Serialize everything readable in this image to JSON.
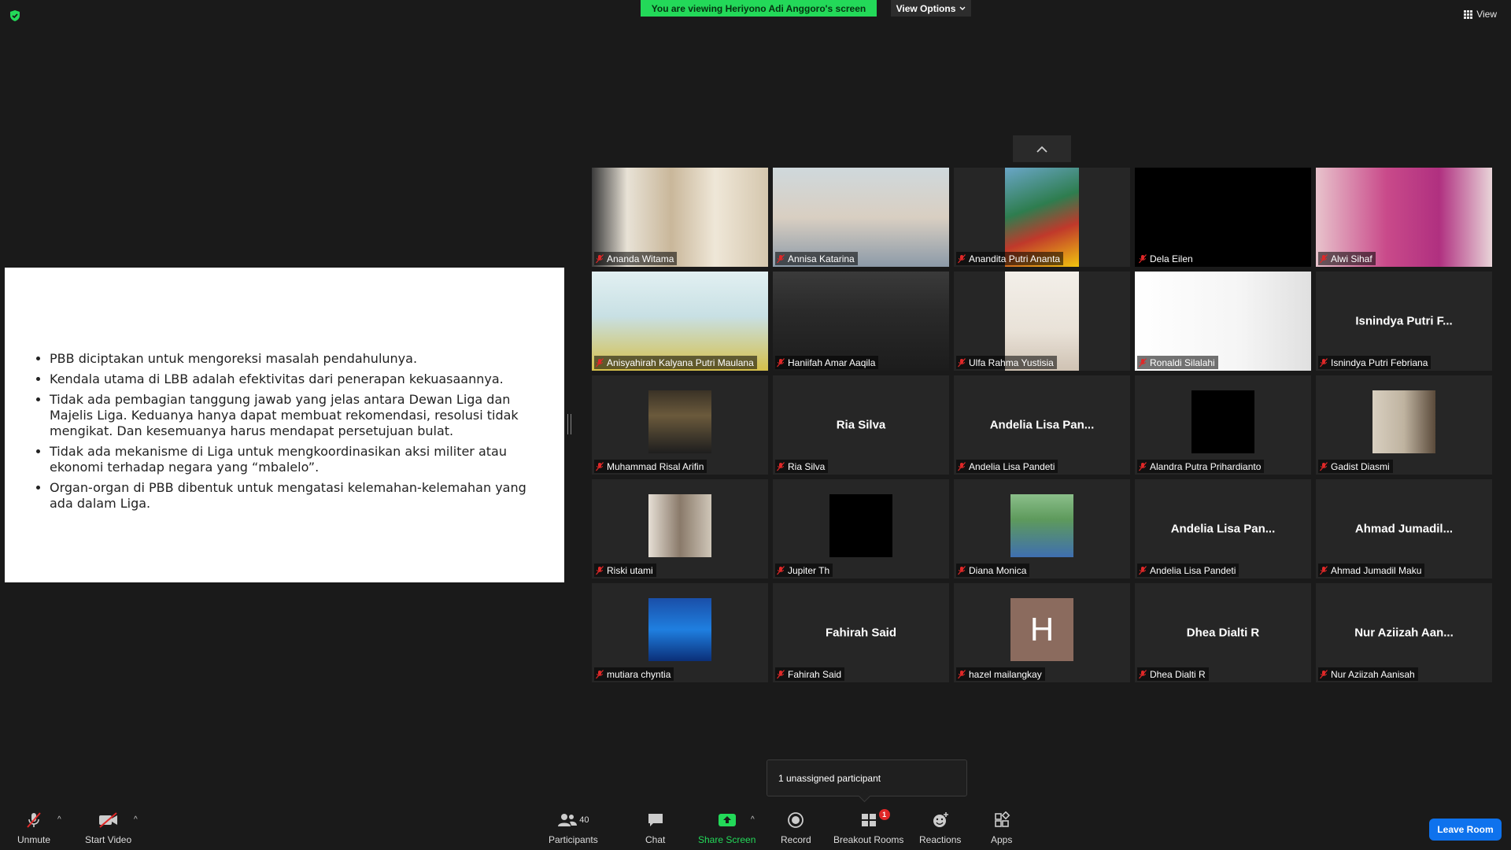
{
  "banner": "You are viewing Heriyono Adi Anggoro's screen",
  "view_options": "View Options",
  "view_button": "View",
  "slide": {
    "bullets": [
      "PBB diciptakan untuk mengoreksi masalah pendahulunya.",
      "Kendala utama di LBB adalah efektivitas dari penerapan kekuasaannya.",
      "Tidak ada pembagian tanggung jawab yang jelas antara Dewan Liga dan Majelis Liga. Keduanya hanya dapat membuat rekomendasi, resolusi tidak mengikat. Dan kesemuanya harus mendapat persetujuan bulat.",
      "Tidak ada mekanisme di Liga untuk mengkoordinasikan aksi militer atau ekonomi terhadap negara yang “mbalelo”.",
      "Organ-organ di PBB dibentuk untuk mengatasi kelemahan-kelemahan yang ada dalam Liga."
    ]
  },
  "participants": [
    {
      "label": "Ananda Witama",
      "center": ""
    },
    {
      "label": "Annisa Katarina",
      "center": ""
    },
    {
      "label": "Anandita Putri Ananta",
      "center": ""
    },
    {
      "label": "Dela Eilen",
      "center": ""
    },
    {
      "label": "Alwi Sihaf",
      "center": ""
    },
    {
      "label": "Anisyahirah Kalyana Putri Maulana",
      "center": ""
    },
    {
      "label": "Haniifah Amar Aaqila",
      "center": ""
    },
    {
      "label": "Ulfa Rahma Yustisia",
      "center": ""
    },
    {
      "label": "Ronaldi Silalahi",
      "center": ""
    },
    {
      "label": "Isnindya Putri Febriana",
      "center": "Isnindya Putri F..."
    },
    {
      "label": "Muhammad Risal Arifin",
      "center": ""
    },
    {
      "label": "Ria Silva",
      "center": "Ria Silva"
    },
    {
      "label": "Andelia Lisa Pandeti",
      "center": "Andelia Lisa Pan..."
    },
    {
      "label": "Alandra Putra Prihardianto",
      "center": ""
    },
    {
      "label": "Gadist Diasmi",
      "center": ""
    },
    {
      "label": "Riski utami",
      "center": ""
    },
    {
      "label": "Jupiter Th",
      "center": ""
    },
    {
      "label": "Diana Monica",
      "center": ""
    },
    {
      "label": "Andelia Lisa Pandeti",
      "center": "Andelia Lisa Pan..."
    },
    {
      "label": "Ahmad Jumadil Maku",
      "center": "Ahmad Jumadil..."
    },
    {
      "label": "mutiara chyntia",
      "center": ""
    },
    {
      "label": "Fahirah Said",
      "center": "Fahirah Said"
    },
    {
      "label": "hazel mailangkay",
      "center": ""
    },
    {
      "label": "Dhea Dialti R",
      "center": "Dhea Dialti R"
    },
    {
      "label": "Nur Aziizah Aanisah",
      "center": "Nur Aziizah Aan..."
    }
  ],
  "avatar_letter": "H",
  "tooltip": "1 unassigned participant",
  "toolbar": {
    "unmute": "Unmute",
    "start_video": "Start Video",
    "participants": "Participants",
    "participants_count": "40",
    "chat": "Chat",
    "share_screen": "Share Screen",
    "record": "Record",
    "breakout_rooms": "Breakout Rooms",
    "breakout_badge": "1",
    "reactions": "Reactions",
    "apps": "Apps",
    "leave_room": "Leave Room"
  },
  "colors": {
    "background": "#1a1a1a",
    "banner_green": "#23d959",
    "leave_blue": "#0e72ed",
    "muted_red": "#e02828",
    "tile_bg": "#262626",
    "avatar_brown": "#8b6b5e"
  }
}
